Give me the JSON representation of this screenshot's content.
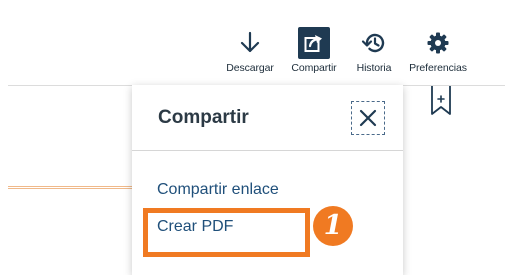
{
  "toolbar": {
    "download_label": "Descargar",
    "share_label": "Compartir",
    "history_label": "Historia",
    "preferences_label": "Preferencias"
  },
  "share_panel": {
    "title": "Compartir",
    "items": [
      {
        "label": "Compartir enlace"
      },
      {
        "label": "Crear PDF"
      }
    ]
  },
  "annotation": {
    "step_number": "1"
  },
  "colors": {
    "accent_orange": "#f07a22",
    "share_active_bg": "#1f3a52",
    "link_blue": "#1f4f7a",
    "icon_dark": "#1f3a52"
  },
  "icons": {
    "download": "download-arrow-icon",
    "share": "share-export-icon",
    "history": "history-clock-icon",
    "preferences": "gear-icon",
    "close": "close-icon",
    "bookmark": "bookmark-add-icon"
  }
}
